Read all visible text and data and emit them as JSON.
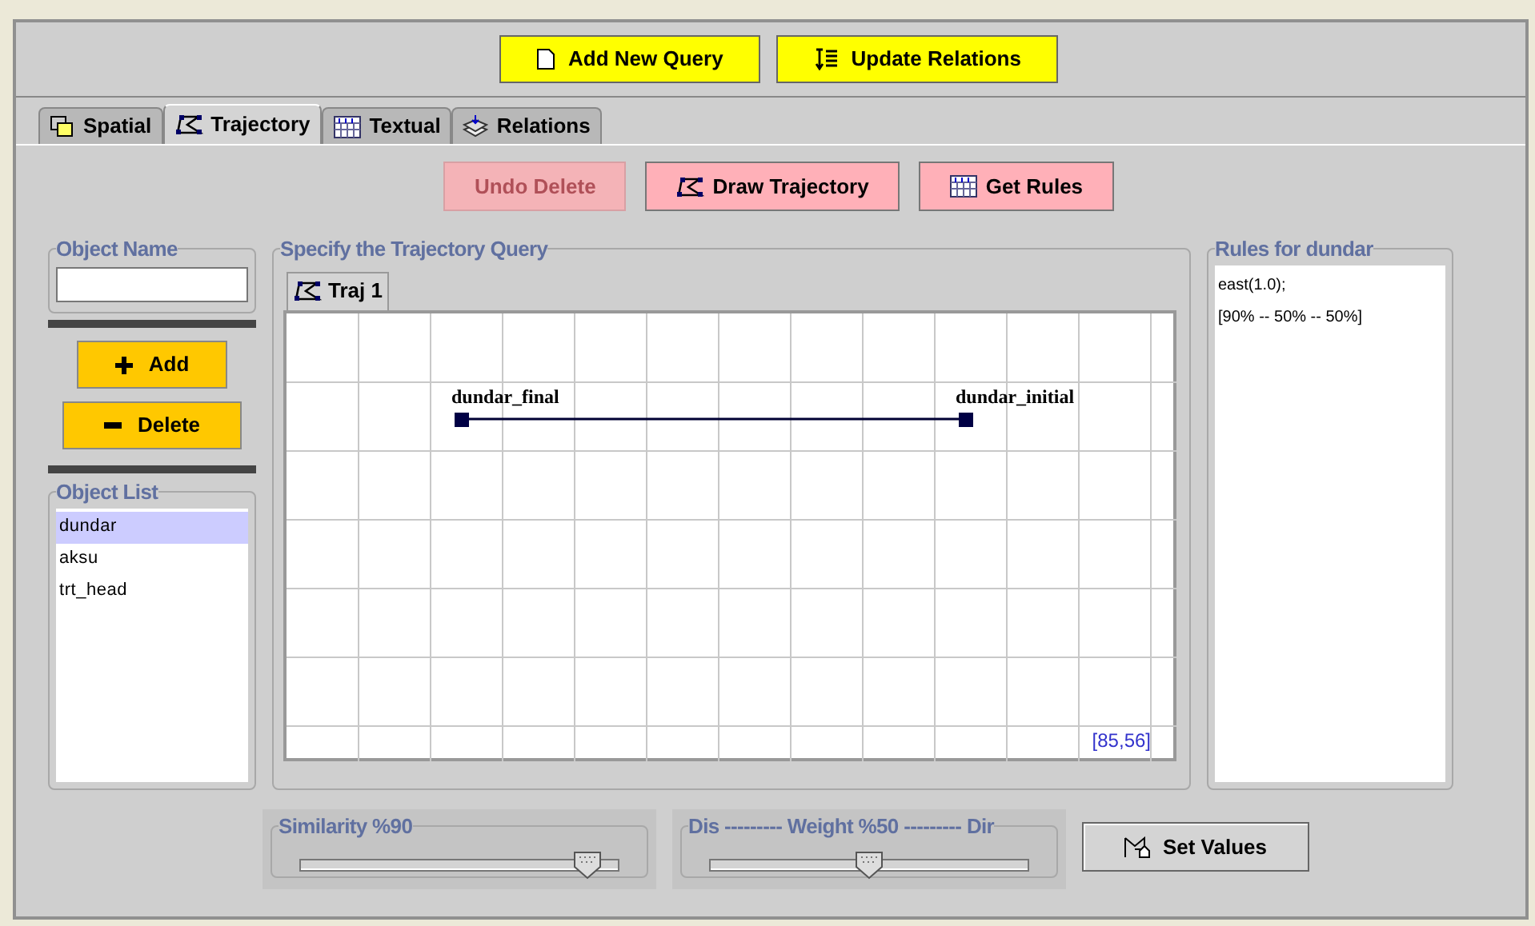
{
  "toolbar": {
    "buttons": [
      {
        "label": "Add New Query",
        "kind": "add"
      },
      {
        "label": "Update Relations",
        "kind": "update"
      }
    ]
  },
  "tabs": [
    {
      "label": "Spatial",
      "kind": "spatial",
      "selected": false
    },
    {
      "label": "Trajectory",
      "kind": "trajectory",
      "selected": true
    },
    {
      "label": "Textual",
      "kind": "textual",
      "selected": false
    },
    {
      "label": "Relations",
      "kind": "relations",
      "selected": false
    }
  ],
  "actions": [
    {
      "label": "Undo Delete",
      "disabled": true
    },
    {
      "label": "Draw Trajectory",
      "kind": "trajectory",
      "disabled": false
    },
    {
      "label": "Get Rules",
      "kind": "textual",
      "disabled": false
    }
  ],
  "object_name": {
    "title": "Object Name"
  },
  "add_button": "Add",
  "delete_button": "Delete",
  "object_list": {
    "title": "Object List",
    "items": [
      {
        "label": "dundar",
        "selected": true
      },
      {
        "label": "aksu",
        "selected": false
      },
      {
        "label": "trt_head",
        "selected": false
      }
    ]
  },
  "query": {
    "title": "Specify the Trajectory Query",
    "tab": "Traj 1",
    "points": [
      {
        "label": "dundar_final"
      },
      {
        "label": "dundar_initial"
      }
    ],
    "coordinates": "[85,56]"
  },
  "rules": {
    "title": "Rules for dundar",
    "lines": [
      "east(1.0);",
      "[90% -- 50% -- 50%]"
    ]
  },
  "similarity": {
    "title": "Similarity %90",
    "level": 0.9
  },
  "weight": {
    "title": "Dis --------- Weight %50 --------- Dir",
    "level": 0.5
  },
  "set_values": "Set Values"
}
